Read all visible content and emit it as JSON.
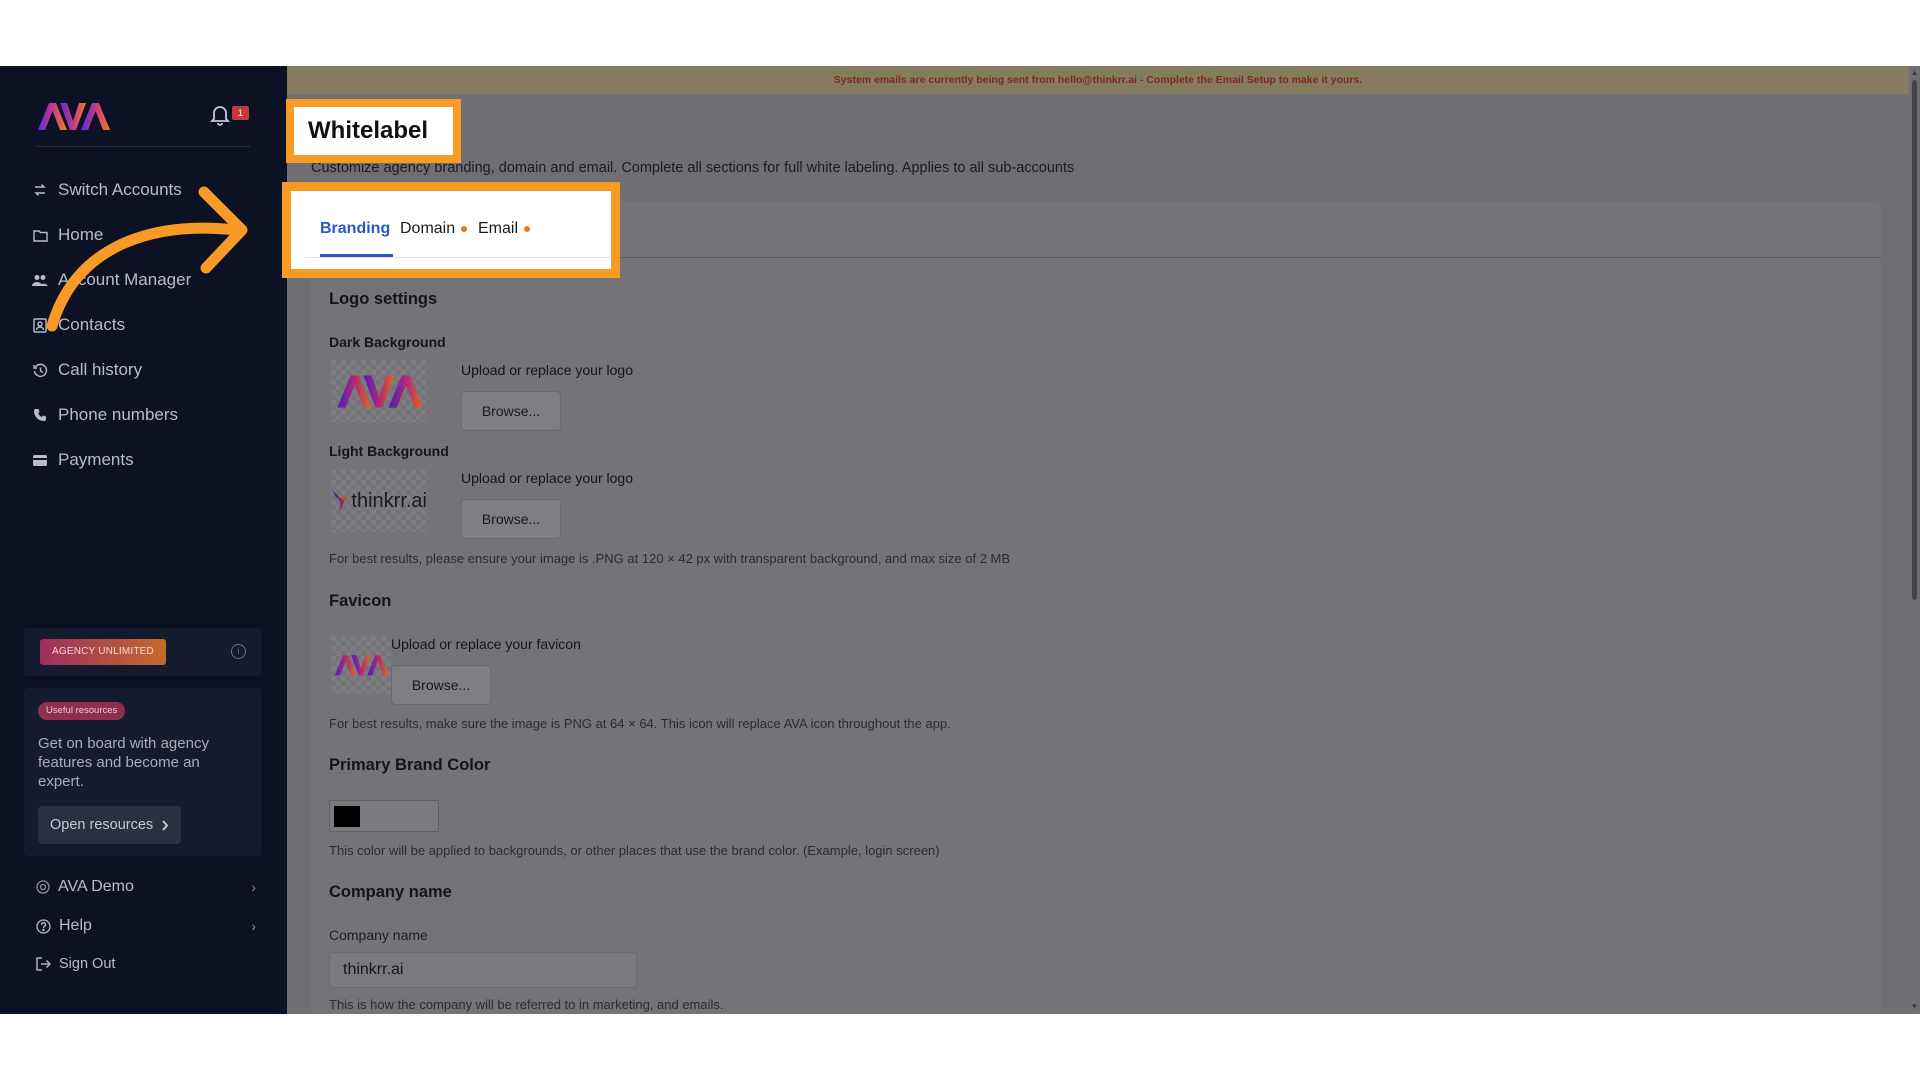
{
  "banner": {
    "text": "System emails are currently being sent from hello@thinkrr.ai - Complete the Email Setup to make it yours."
  },
  "sidebar": {
    "logo_text": "AVA",
    "notification_count": "1",
    "items": [
      {
        "label": "Switch Accounts",
        "icon": "switch-icon"
      },
      {
        "label": "Home",
        "icon": "folder-icon"
      },
      {
        "label": "Account Manager",
        "icon": "users-icon"
      },
      {
        "label": "Contacts",
        "icon": "contacts-icon"
      },
      {
        "label": "Call history",
        "icon": "history-icon"
      },
      {
        "label": "Phone numbers",
        "icon": "phone-icon"
      },
      {
        "label": "Payments",
        "icon": "card-icon"
      }
    ],
    "plan_badge": "AGENCY UNLIMITED",
    "plan_info": "i",
    "resources": {
      "badge": "Useful resources",
      "text": "Get on board with agency features and become an expert.",
      "button": "Open resources"
    },
    "footer": [
      {
        "label": "AVA Demo",
        "icon": "target-icon",
        "chevron": true
      },
      {
        "label": "Help",
        "icon": "help-icon",
        "chevron": true
      },
      {
        "label": "Sign Out",
        "icon": "signout-icon",
        "chevron": false
      }
    ]
  },
  "page": {
    "title": "Whitelabel",
    "description": "Customize agency branding, domain and email. Complete all sections for full white labeling. Applies to all sub-accounts"
  },
  "tabs": [
    {
      "label": "Branding",
      "active": true,
      "dot": false
    },
    {
      "label": "Domain",
      "active": false,
      "dot": true
    },
    {
      "label": "Email",
      "active": false,
      "dot": true
    }
  ],
  "branding": {
    "logo_settings_title": "Logo settings",
    "dark_bg_label": "Dark Background",
    "light_bg_label": "Light Background",
    "upload_logo_label": "Upload or replace your logo",
    "browse_label": "Browse...",
    "light_logo_text": "thinkrr.ai",
    "logo_help": "For best results, please ensure your image is .PNG at 120 × 42 px with transparent background, and max size of 2 MB",
    "favicon_title": "Favicon",
    "upload_favicon_label": "Upload or replace your favicon",
    "favicon_help": "For best results, make sure the image is PNG at 64 × 64. This icon will replace AVA icon throughout the app.",
    "brand_color_title": "Primary Brand Color",
    "brand_color_value": "#000000",
    "brand_color_help": "This color will be applied to backgrounds, or other places that use the brand color. (Example, login screen)",
    "company_section_title": "Company name",
    "company_field_label": "Company name",
    "company_value": "thinkrr.ai",
    "company_help": "This is how the company will be referred to in marketing, and emails."
  },
  "colors": {
    "highlight": "#f79a26",
    "active_tab": "#2d56cc",
    "sidebar_bg": "#0c1224"
  }
}
